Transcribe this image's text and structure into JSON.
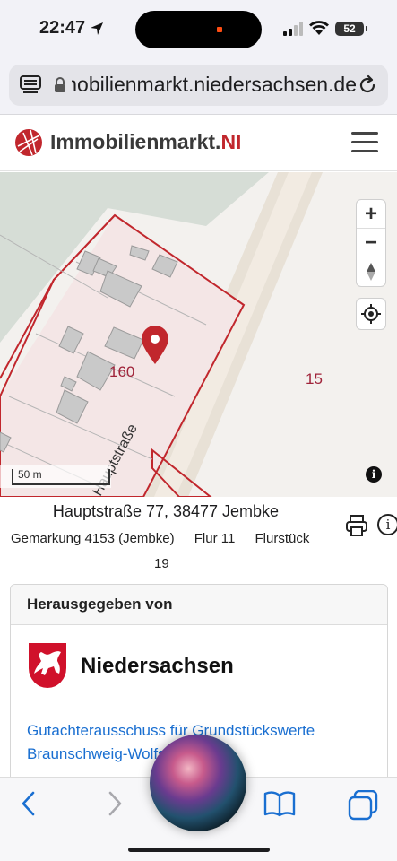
{
  "status_bar": {
    "time": "22:47",
    "battery": "52"
  },
  "browser": {
    "url": "immobilienmarkt.niedersachsen.de"
  },
  "site": {
    "brand_main": "Immobilienmarkt.",
    "brand_accent": "NI",
    "accent_color": "#c1272d"
  },
  "map": {
    "parcel_label_main": "160",
    "parcel_label_right": "15",
    "street_label": "Hauptstraße",
    "scale_label": "50 m",
    "zoom_in": "+",
    "zoom_out": "−",
    "info": "i"
  },
  "property": {
    "address": "Hauptstraße 77, 38477 Jembke",
    "gemarkung": "Gemarkung 4153 (Jembke)",
    "flur": "Flur 11",
    "flurstueck_label": "Flurstück",
    "flurstueck_value": "19"
  },
  "publisher": {
    "heading": "Herausgegeben von",
    "state_name": "Niedersachsen",
    "link_text": "Gutachterausschuss für Grundstückswerte Braunschweig-Wolfsburg"
  }
}
